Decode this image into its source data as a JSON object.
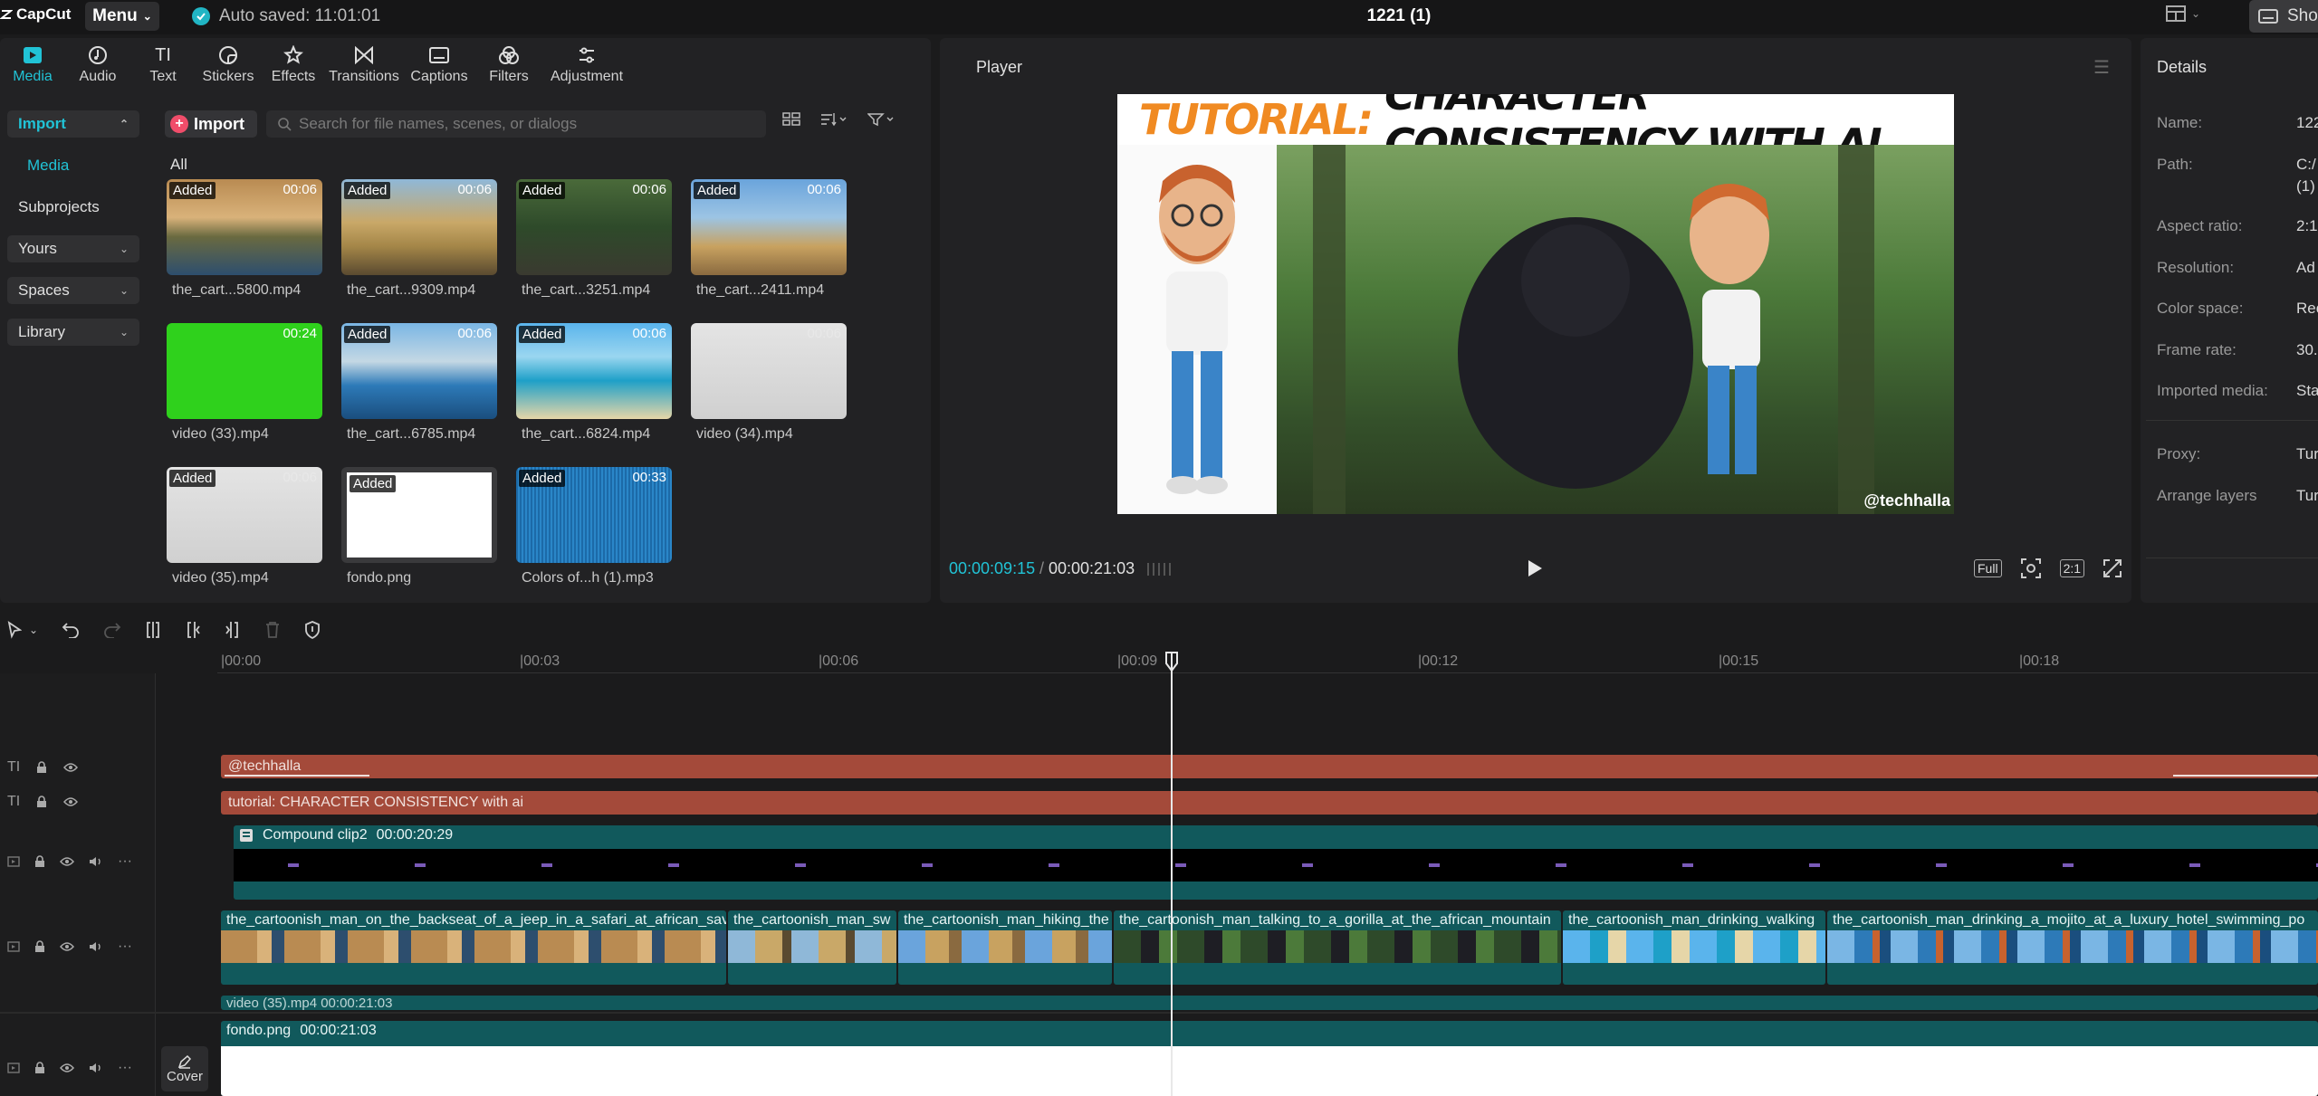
{
  "app": {
    "logo": "CapCut",
    "menu_label": "Menu",
    "autosave": "Auto saved: 11:01:01",
    "project_title": "1221 (1)",
    "show_label": "Sho"
  },
  "toolbar": [
    {
      "label": "Media",
      "icon": "media-icon"
    },
    {
      "label": "Audio",
      "icon": "audio-icon"
    },
    {
      "label": "Text",
      "icon": "text-icon"
    },
    {
      "label": "Stickers",
      "icon": "stickers-icon"
    },
    {
      "label": "Effects",
      "icon": "effects-icon"
    },
    {
      "label": "Transitions",
      "icon": "transitions-icon"
    },
    {
      "label": "Captions",
      "icon": "captions-icon"
    },
    {
      "label": "Filters",
      "icon": "filters-icon"
    },
    {
      "label": "Adjustment",
      "icon": "adjustment-icon"
    }
  ],
  "sidebar": {
    "import": "Import",
    "media": "Media",
    "subprojects": "Subprojects",
    "yours": "Yours",
    "spaces": "Spaces",
    "library": "Library"
  },
  "media_panel": {
    "import_button": "Import",
    "search_placeholder": "Search for file names, scenes, or dialogs",
    "all_label": "All",
    "items": [
      {
        "name": "the_cart...5800.mp4",
        "badge": "Added",
        "duration": "00:06"
      },
      {
        "name": "the_cart...9309.mp4",
        "badge": "Added",
        "duration": "00:06"
      },
      {
        "name": "the_cart...3251.mp4",
        "badge": "Added",
        "duration": "00:06"
      },
      {
        "name": "the_cart...2411.mp4",
        "badge": "Added",
        "duration": "00:06"
      },
      {
        "name": "video (33).mp4",
        "badge": "",
        "duration": "00:24"
      },
      {
        "name": "the_cart...6785.mp4",
        "badge": "Added",
        "duration": "00:06"
      },
      {
        "name": "the_cart...6824.mp4",
        "badge": "Added",
        "duration": "00:06"
      },
      {
        "name": "video (34).mp4",
        "badge": "",
        "duration": "00:06"
      },
      {
        "name": "video (35).mp4",
        "badge": "Added",
        "duration": "00:06"
      },
      {
        "name": "fondo.png",
        "badge": "Added",
        "duration": ""
      },
      {
        "name": "Colors of...h (1).mp3",
        "badge": "Added",
        "duration": "00:33"
      }
    ]
  },
  "player": {
    "title": "Player",
    "video_title_orange": "TUTORIAL:",
    "video_title_black": "CHARACTER CONSISTENCY WITH AI",
    "watermark": "@techhalla",
    "current_time": "00:00:09:15",
    "separator": "/",
    "total_time": "00:00:21:03",
    "full_label": "Full",
    "ratio_label": "2:1"
  },
  "details": {
    "title": "Details",
    "rows": [
      {
        "label": "Name:",
        "value": "122"
      },
      {
        "label": "Path:",
        "value": "C:/"
      },
      {
        "label": "",
        "value": "(1)"
      },
      {
        "label": "Aspect ratio:",
        "value": "2:1"
      },
      {
        "label": "Resolution:",
        "value": "Ad"
      },
      {
        "label": "Color space:",
        "value": "Rec"
      },
      {
        "label": "Frame rate:",
        "value": "30."
      },
      {
        "label": "Imported media:",
        "value": "Sta"
      },
      {
        "label": "Proxy:",
        "value": "Tur"
      },
      {
        "label": "Arrange layers",
        "value": "Tur"
      }
    ]
  },
  "timeline": {
    "ruler": [
      "00:00",
      "00:03",
      "00:06",
      "00:09",
      "00:12",
      "00:15",
      "00:18"
    ],
    "text_track_1": "@techhalla",
    "text_track_2": "tutorial: CHARACTER CONSISTENCY with ai",
    "compound_clip": "Compound clip2",
    "compound_duration": "00:00:20:29",
    "main_clips": [
      "the_cartoonish_man_on_the_backseat_of_a_jeep_in_a_safari_at_african_sav",
      "the_cartoonish_man_sw",
      "the_cartoonish_man_hiking_the",
      "the_cartoonish_man_talking_to_a_gorilla_at_the_african_mountain",
      "the_cartoonish_man_drinking_walking",
      "the_cartoonish_man_drinking_a_mojito_at_a_luxury_hotel_swimming_po"
    ],
    "partial_clip": "video (35).mp4   00:00:21:03",
    "fondo_clip": "fondo.png",
    "fondo_duration": "00:00:21:03",
    "cover_label": "Cover"
  },
  "colors": {
    "accent": "#21c3d6",
    "text_clip": "#a44a3a",
    "video_clip": "#11595c",
    "title_orange": "#f08a22"
  }
}
